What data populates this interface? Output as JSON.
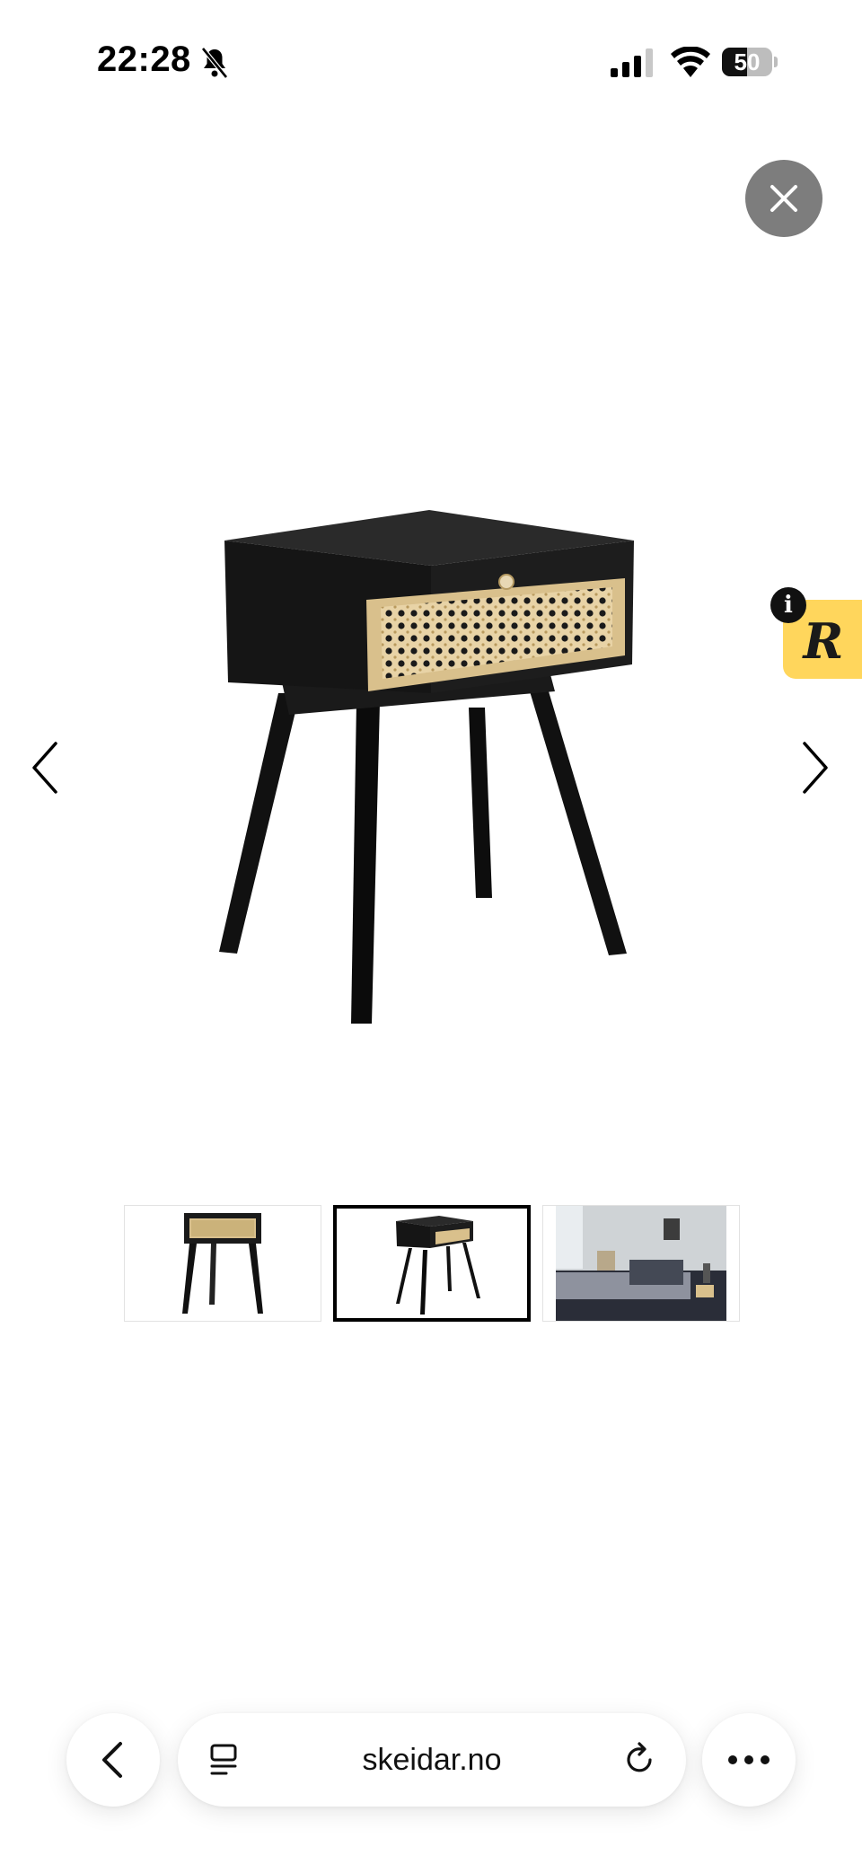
{
  "status_bar": {
    "time": "22:28",
    "battery_level": "50",
    "battery_fraction": 0.5
  },
  "viewer": {
    "close_icon": "close-icon",
    "prev_icon": "chevron-left-icon",
    "next_icon": "chevron-right-icon",
    "thumbnails": [
      {
        "name": "thumbnail-1",
        "selected": false
      },
      {
        "name": "thumbnail-2",
        "selected": true
      },
      {
        "name": "thumbnail-3",
        "selected": false
      }
    ]
  },
  "widget": {
    "letter": "R",
    "info": "i",
    "color": "#ffd65c"
  },
  "browser": {
    "url": "skeidar.no"
  },
  "colors": {
    "close_button": "#7d7d7d",
    "background": "#ffffff"
  }
}
